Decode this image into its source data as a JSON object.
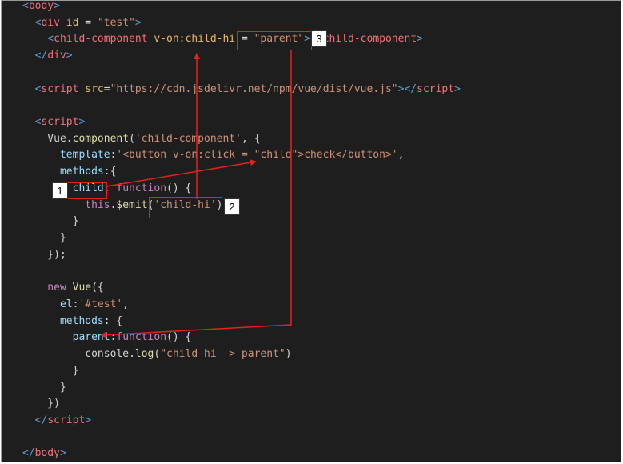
{
  "code_lines": [
    [
      {
        "t": "<",
        "c": "tag"
      },
      {
        "t": "body",
        "c": "tname"
      },
      {
        "t": ">",
        "c": "tag"
      }
    ],
    [
      {
        "t": "  <",
        "c": "tag"
      },
      {
        "t": "div ",
        "c": "tname"
      },
      {
        "t": "id",
        "c": "attr"
      },
      {
        "t": " = ",
        "c": "pun"
      },
      {
        "t": "\"test\"",
        "c": "str"
      },
      {
        "t": ">",
        "c": "tag"
      }
    ],
    [
      {
        "t": "    <",
        "c": "tag"
      },
      {
        "t": "child-component ",
        "c": "tname"
      },
      {
        "t": "v-on:child-hi",
        "c": "attr"
      },
      {
        "t": " = ",
        "c": "pun"
      },
      {
        "t": "\"parent\"",
        "c": "str"
      },
      {
        "t": "></",
        "c": "tag"
      },
      {
        "t": "child-component",
        "c": "tname"
      },
      {
        "t": ">",
        "c": "tag"
      }
    ],
    [
      {
        "t": "  </",
        "c": "tag"
      },
      {
        "t": "div",
        "c": "tname"
      },
      {
        "t": ">",
        "c": "tag"
      }
    ],
    [],
    [
      {
        "t": "  <",
        "c": "tag"
      },
      {
        "t": "script ",
        "c": "tname"
      },
      {
        "t": "src",
        "c": "attr"
      },
      {
        "t": "=",
        "c": "pun"
      },
      {
        "t": "\"https://cdn.jsdelivr.net/npm/vue/dist/vue.js\"",
        "c": "str"
      },
      {
        "t": "></",
        "c": "tag"
      },
      {
        "t": "script",
        "c": "tname"
      },
      {
        "t": ">",
        "c": "tag"
      }
    ],
    [],
    [
      {
        "t": "  <",
        "c": "tag"
      },
      {
        "t": "script",
        "c": "tname"
      },
      {
        "t": ">",
        "c": "tag"
      }
    ],
    [
      {
        "t": "    Vue",
        "c": "pun"
      },
      {
        "t": ".",
        "c": "pun"
      },
      {
        "t": "component",
        "c": "fn"
      },
      {
        "t": "(",
        "c": "pun"
      },
      {
        "t": "'child-component'",
        "c": "str"
      },
      {
        "t": ", {",
        "c": "pun"
      }
    ],
    [
      {
        "t": "      template",
        "c": "prop"
      },
      {
        "t": ":",
        "c": "pun"
      },
      {
        "t": "'<button v-on:click = \"child\">check</button>'",
        "c": "str"
      },
      {
        "t": ",",
        "c": "pun"
      }
    ],
    [
      {
        "t": "      methods",
        "c": "prop"
      },
      {
        "t": ":{",
        "c": "pun"
      }
    ],
    [
      {
        "t": "        child",
        "c": "prop"
      },
      {
        "t": ": ",
        "c": "pun"
      },
      {
        "t": "function",
        "c": "kw"
      },
      {
        "t": "() {",
        "c": "pun"
      }
    ],
    [
      {
        "t": "          this",
        "c": "kw"
      },
      {
        "t": ".",
        "c": "pun"
      },
      {
        "t": "$emit",
        "c": "fn"
      },
      {
        "t": "(",
        "c": "pun"
      },
      {
        "t": "'child-hi'",
        "c": "str"
      },
      {
        "t": ");",
        "c": "pun"
      }
    ],
    [
      {
        "t": "        }",
        "c": "pun"
      }
    ],
    [
      {
        "t": "      }",
        "c": "pun"
      }
    ],
    [
      {
        "t": "    });",
        "c": "pun"
      }
    ],
    [],
    [
      {
        "t": "    new ",
        "c": "kw"
      },
      {
        "t": "Vue",
        "c": "fn"
      },
      {
        "t": "({",
        "c": "pun"
      }
    ],
    [
      {
        "t": "      el",
        "c": "prop"
      },
      {
        "t": ":",
        "c": "pun"
      },
      {
        "t": "'#test'",
        "c": "str"
      },
      {
        "t": ",",
        "c": "pun"
      }
    ],
    [
      {
        "t": "      methods",
        "c": "prop"
      },
      {
        "t": ": {",
        "c": "pun"
      }
    ],
    [
      {
        "t": "        parent",
        "c": "prop"
      },
      {
        "t": ":",
        "c": "pun"
      },
      {
        "t": "function",
        "c": "kw"
      },
      {
        "t": "() {",
        "c": "pun"
      }
    ],
    [
      {
        "t": "          console",
        "c": "pun"
      },
      {
        "t": ".",
        "c": "pun"
      },
      {
        "t": "log",
        "c": "fn"
      },
      {
        "t": "(",
        "c": "pun"
      },
      {
        "t": "\"child-hi -> parent\"",
        "c": "str"
      },
      {
        "t": ")",
        "c": "pun"
      }
    ],
    [
      {
        "t": "        }",
        "c": "pun"
      }
    ],
    [
      {
        "t": "      }",
        "c": "pun"
      }
    ],
    [
      {
        "t": "    })",
        "c": "pun"
      }
    ],
    [
      {
        "t": "  </",
        "c": "tag"
      },
      {
        "t": "script",
        "c": "tname"
      },
      {
        "t": ">",
        "c": "tag"
      }
    ],
    [],
    [
      {
        "t": "</",
        "c": "tag"
      },
      {
        "t": "body",
        "c": "tname"
      },
      {
        "t": ">",
        "c": "tag"
      }
    ]
  ],
  "annotations": {
    "badge_1": "1",
    "badge_2": "2",
    "badge_3": "3"
  },
  "colors": {
    "background": "#1e1e1e",
    "annotation": "#e0241c"
  }
}
